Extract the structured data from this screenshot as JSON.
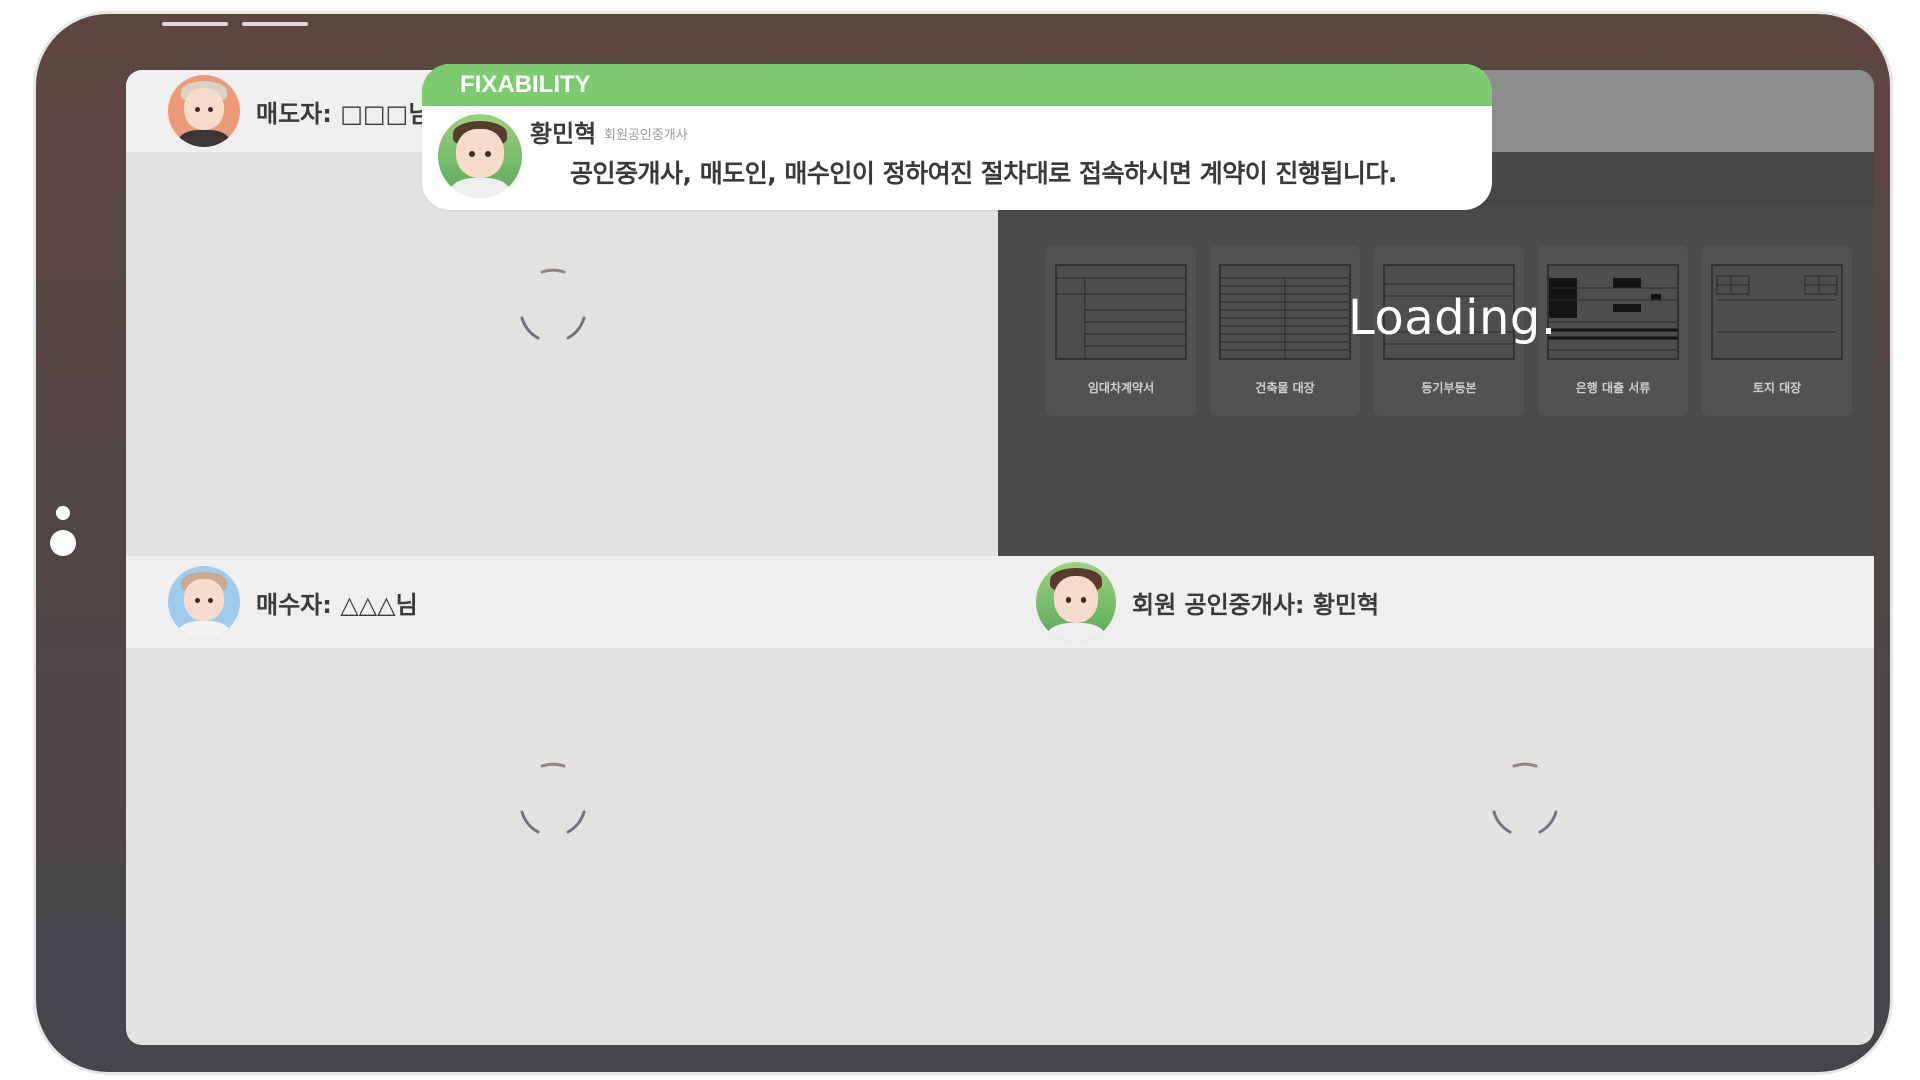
{
  "banner": {
    "brand": "FIXABILITY",
    "sender_name": "황민혁",
    "sender_role": "회원공인중개사",
    "message": "공인중개사, 매도인, 매수인이 정하여진 절차대로 접속하시면 계약이 진행됩니다."
  },
  "participants": {
    "seller": {
      "label": "매도자: □□□님"
    },
    "buyer": {
      "label": "매수자: △△△님"
    },
    "agent": {
      "label": "회원 공인중개사: 황민혁"
    }
  },
  "documents": {
    "loading_text": "Loading.",
    "items": [
      {
        "label": "임대차계약서"
      },
      {
        "label": "건축물 대장"
      },
      {
        "label": "등기부등본"
      },
      {
        "label": "은행 대출 서류"
      },
      {
        "label": "토지 대장"
      }
    ]
  },
  "colors": {
    "banner_accent": "#7ccb6e",
    "frame": "#5d463f",
    "pane_bg": "#e3e2e1",
    "doc_pane_bg": "#4a4a4a"
  }
}
